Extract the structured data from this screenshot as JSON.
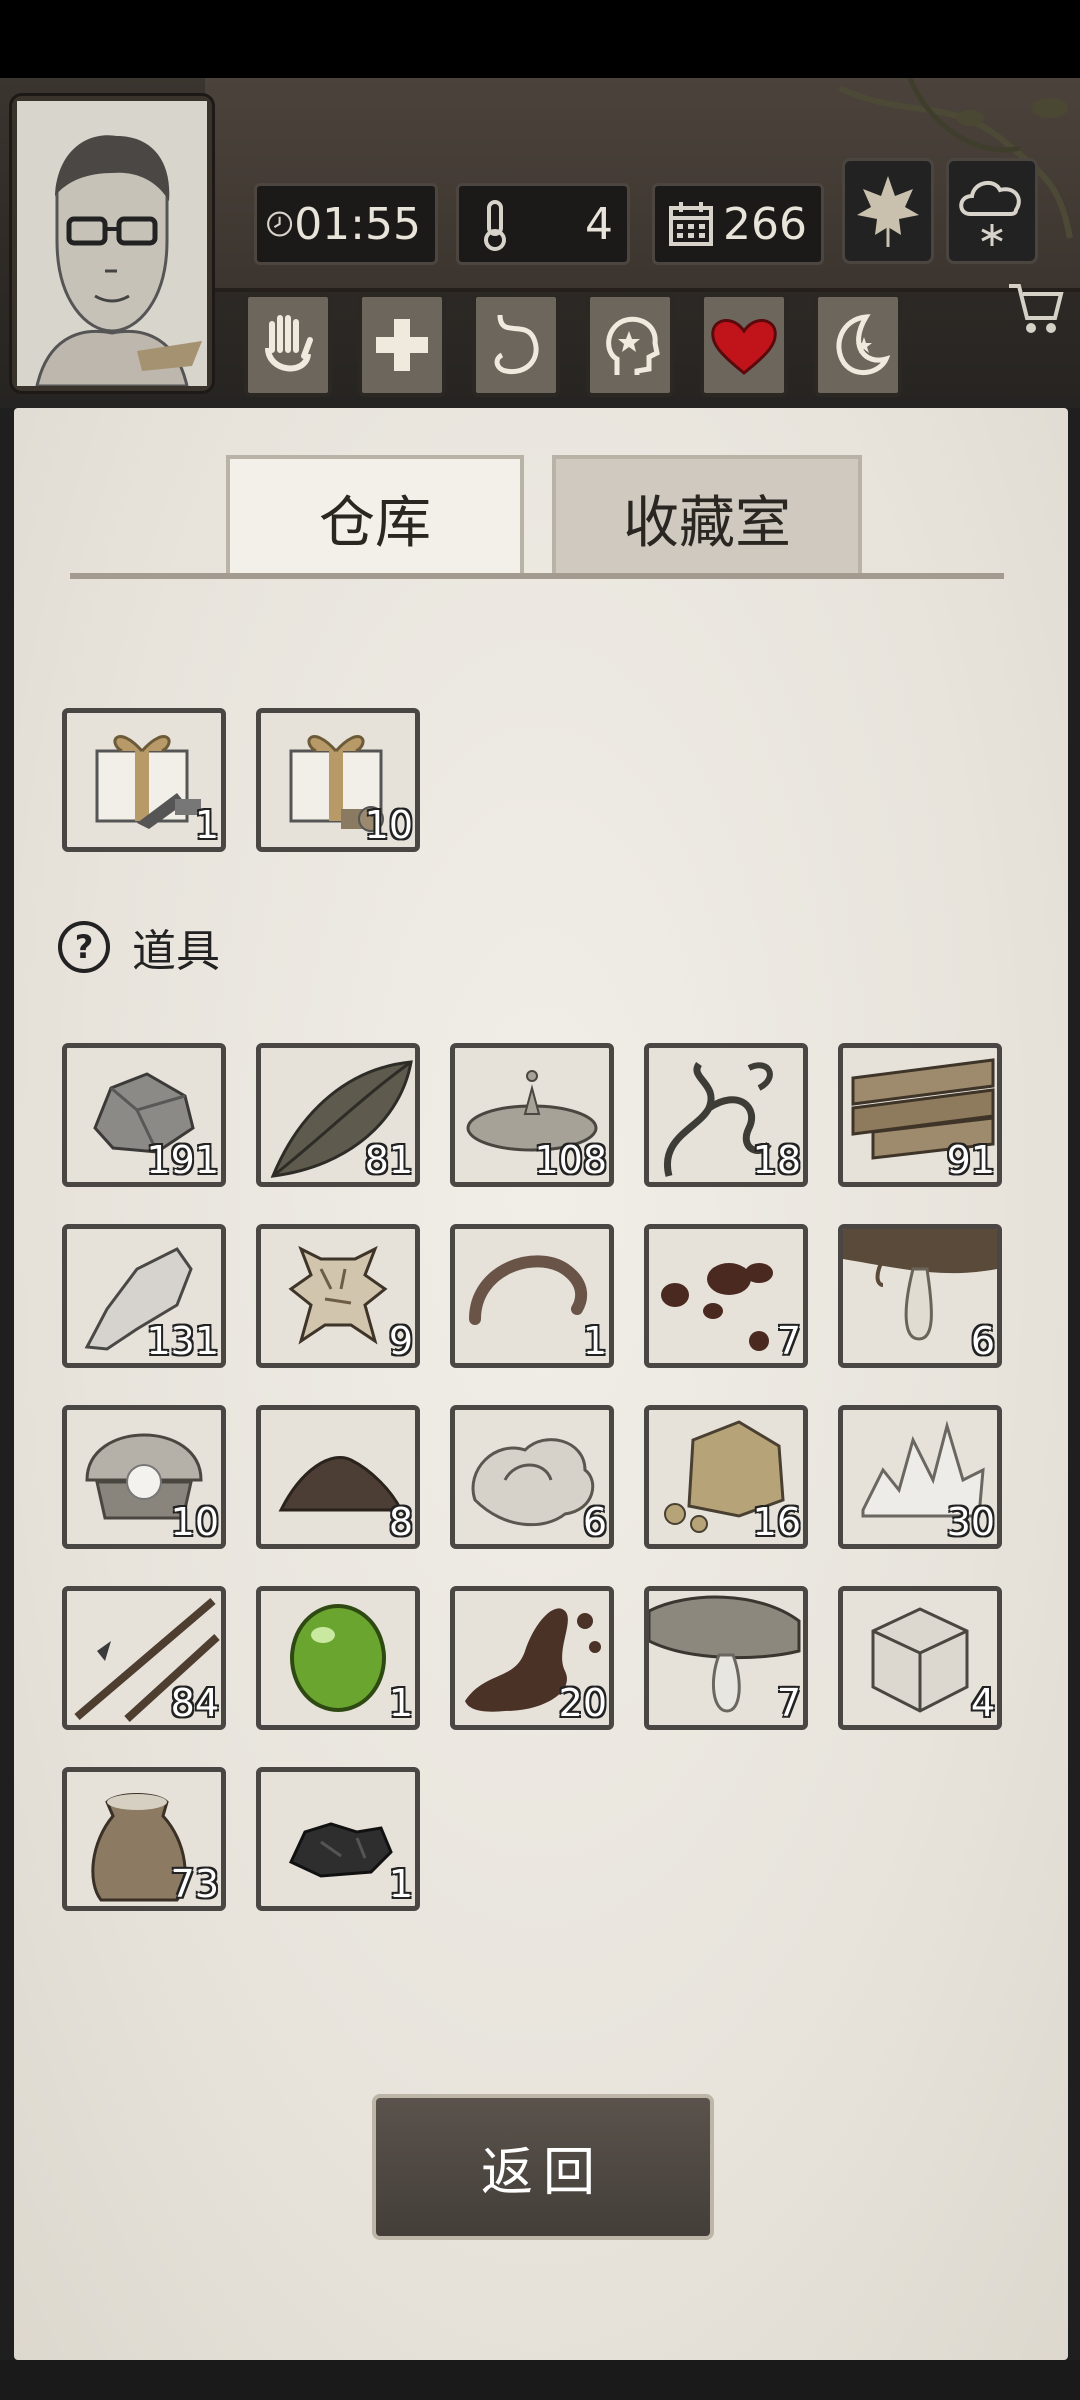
{
  "status": {
    "time": "01:55",
    "temperature": "4",
    "day": "266"
  },
  "weather": {
    "season_icon": "maple-leaf-icon",
    "weather_icon": "snow-cloud-icon"
  },
  "toolbar": [
    {
      "name": "hand-icon"
    },
    {
      "name": "medical-cross-icon"
    },
    {
      "name": "stomach-icon"
    },
    {
      "name": "mind-icon"
    },
    {
      "name": "heart-icon"
    },
    {
      "name": "moon-star-icon"
    }
  ],
  "tabs": {
    "warehouse": "仓库",
    "collection": "收藏室"
  },
  "gifts": [
    {
      "name": "gift-box-tools",
      "count": "1"
    },
    {
      "name": "gift-box-wood",
      "count": "10"
    }
  ],
  "section": {
    "title": "道具",
    "help_symbol": "?"
  },
  "items": [
    {
      "name": "stone-item",
      "count": "191"
    },
    {
      "name": "leaf-item",
      "count": "81"
    },
    {
      "name": "water-puddle-item",
      "count": "108"
    },
    {
      "name": "vine-item",
      "count": "18"
    },
    {
      "name": "wood-plank-item",
      "count": "91"
    },
    {
      "name": "flint-item",
      "count": "131"
    },
    {
      "name": "animal-hide-item",
      "count": "9"
    },
    {
      "name": "worm-item",
      "count": "1"
    },
    {
      "name": "blood-drops-item",
      "count": "7"
    },
    {
      "name": "tree-sap-item",
      "count": "6"
    },
    {
      "name": "pearl-shell-item",
      "count": "10"
    },
    {
      "name": "dirt-pile-item",
      "count": "8"
    },
    {
      "name": "wool-item",
      "count": "6"
    },
    {
      "name": "clay-rock-item",
      "count": "16"
    },
    {
      "name": "salt-crystal-item",
      "count": "30"
    },
    {
      "name": "spear-item",
      "count": "84"
    },
    {
      "name": "green-gem-item",
      "count": "1"
    },
    {
      "name": "mud-splash-item",
      "count": "20"
    },
    {
      "name": "fish-oil-item",
      "count": "7"
    },
    {
      "name": "cube-box-item",
      "count": "4"
    },
    {
      "name": "grain-sack-item",
      "count": "73"
    },
    {
      "name": "coal-item",
      "count": "1"
    }
  ],
  "buttons": {
    "back": "返回"
  },
  "colors": {
    "paper": "#ece8e0",
    "slot_border": "#4a4643",
    "heart": "#c0141a"
  }
}
